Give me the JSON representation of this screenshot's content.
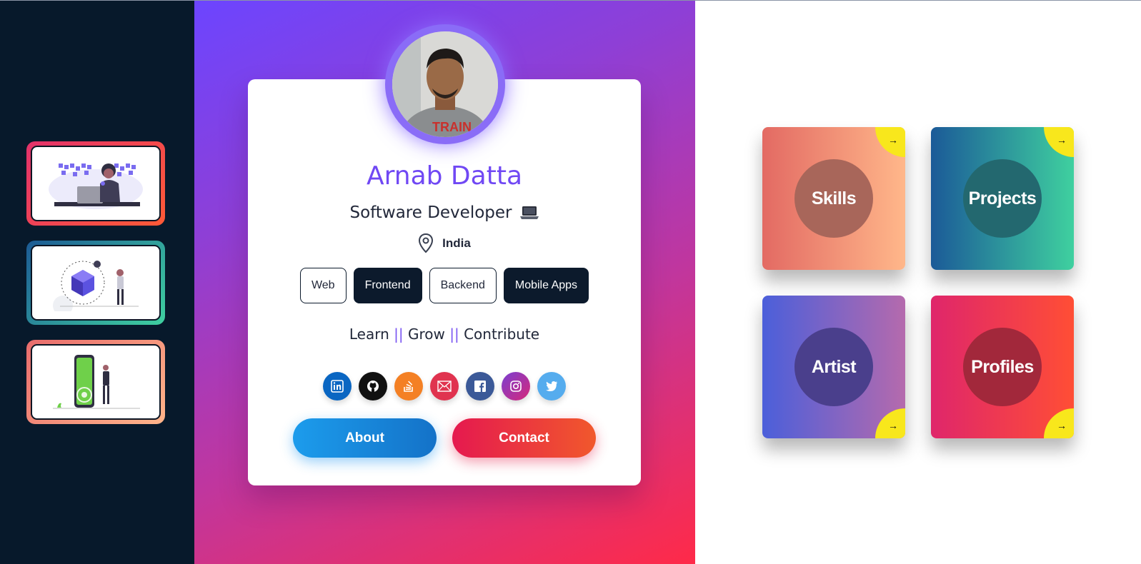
{
  "profile": {
    "name": "Arnab Datta",
    "role": "Software Developer",
    "location": "India"
  },
  "tags": [
    "Web",
    "Frontend",
    "Backend",
    "Mobile Apps"
  ],
  "motto": {
    "part1": "Learn",
    "sep": "||",
    "part2": "Grow",
    "part3": "Contribute"
  },
  "socials": [
    {
      "name": "linkedin-icon",
      "color": "#0a66c2"
    },
    {
      "name": "github-icon",
      "color": "#111111"
    },
    {
      "name": "stackoverflow-icon",
      "color": "#f48024"
    },
    {
      "name": "mail-icon",
      "color": "#e0334f"
    },
    {
      "name": "facebook-icon",
      "color": "#3b5998"
    },
    {
      "name": "instagram-icon",
      "color": "#c13584"
    },
    {
      "name": "twitter-icon",
      "color": "#55acee"
    }
  ],
  "buttons": {
    "about": "About",
    "contact": "Contact"
  },
  "tiles": {
    "skills": "Skills",
    "projects": "Projects",
    "artist": "Artist",
    "profiles": "Profiles",
    "arrow": "→"
  }
}
